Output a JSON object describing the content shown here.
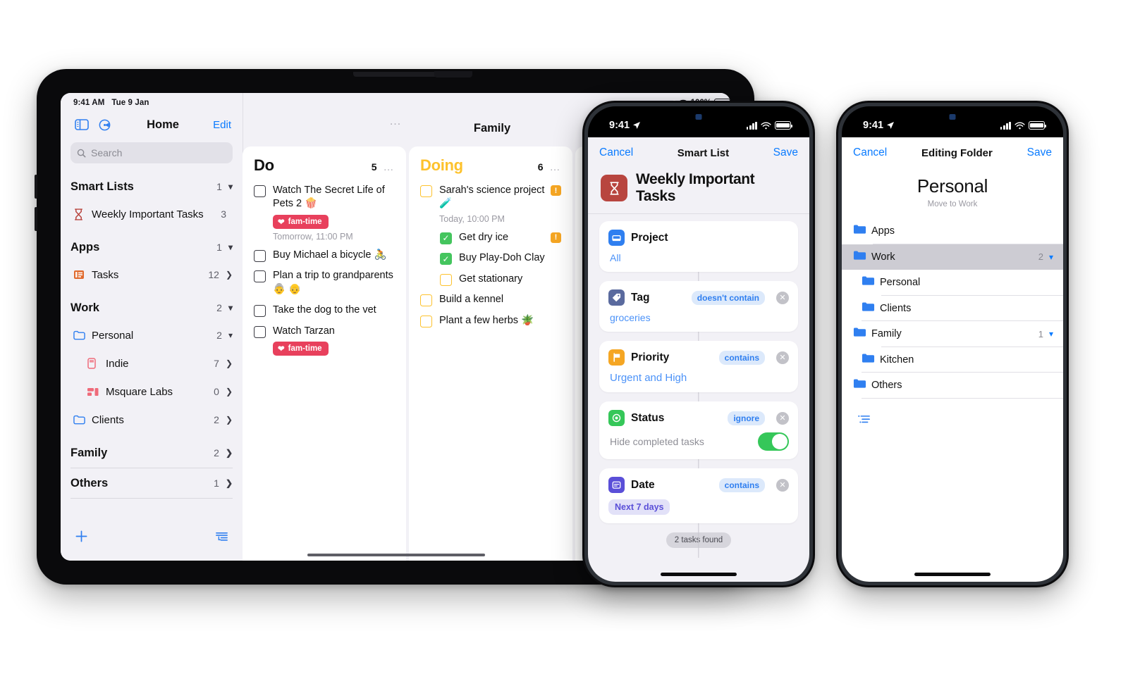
{
  "ipad": {
    "status": {
      "time": "9:41 AM",
      "date": "Tue 9 Jan",
      "battery": "100%"
    },
    "sidebar": {
      "title": "Home",
      "edit_label": "Edit",
      "search_placeholder": "Search",
      "sections": [
        {
          "name": "Smart Lists",
          "count": "1",
          "chevron": "down",
          "items": [
            {
              "label": "Weekly Important Tasks",
              "count": "3",
              "icon": "hourglass-icon",
              "trail": "none",
              "indent": 1
            }
          ]
        },
        {
          "name": "Apps",
          "count": "1",
          "chevron": "down",
          "items": [
            {
              "label": "Tasks",
              "count": "12",
              "icon": "tasks-app-icon",
              "trail": "chevron-right",
              "indent": 1
            }
          ]
        },
        {
          "name": "Work",
          "count": "2",
          "chevron": "down",
          "items": [
            {
              "label": "Personal",
              "count": "2",
              "icon": "folder-icon",
              "trail": "chevron-down",
              "indent": 1
            },
            {
              "label": "Indie",
              "count": "7",
              "icon": "indie-list-icon",
              "trail": "chevron-right",
              "indent": 2
            },
            {
              "label": "Msquare Labs",
              "count": "0",
              "icon": "msquare-list-icon",
              "trail": "chevron-right",
              "indent": 2
            },
            {
              "label": "Clients",
              "count": "2",
              "icon": "folder-icon",
              "trail": "chevron-right",
              "indent": 1
            }
          ]
        },
        {
          "name": "Family",
          "count": "2",
          "chevron": "right",
          "items": []
        },
        {
          "name": "Others",
          "count": "1",
          "chevron": "right",
          "items": []
        }
      ],
      "footer": {
        "add": "add-icon",
        "sort": "sort-options-icon"
      }
    },
    "content": {
      "title": "Family",
      "overflow": "more-options-icon",
      "columns": [
        {
          "name": "Do",
          "count": "5",
          "accent": "#111111",
          "tasks": [
            {
              "title": "Watch The Secret Life of Pets 2 🍿",
              "state": "open",
              "tag": "fam-time",
              "due": "Tomorrow, 11:00 PM",
              "priority": "",
              "sub": false
            },
            {
              "title": "Buy Michael a bicycle 🚴",
              "state": "open",
              "tag": "",
              "due": "",
              "priority": "",
              "sub": false
            },
            {
              "title": "Plan a trip to grandparents 👵 👴",
              "state": "open",
              "tag": "",
              "due": "",
              "priority": "",
              "sub": false
            },
            {
              "title": "Take the dog to the vet",
              "state": "open",
              "tag": "",
              "due": "",
              "priority": "",
              "sub": false
            },
            {
              "title": "Watch Tarzan",
              "state": "open",
              "tag": "fam-time",
              "due": "",
              "priority": "",
              "sub": false
            }
          ]
        },
        {
          "name": "Doing",
          "count": "6",
          "accent": "#fdc22d",
          "tasks": [
            {
              "title": "Sarah's science project 🧪",
              "state": "open-yellow",
              "tag": "",
              "due": "Today, 10:00 PM",
              "priority": "!",
              "sub": false
            },
            {
              "title": "Get dry ice",
              "state": "done",
              "tag": "",
              "due": "",
              "priority": "!",
              "sub": true
            },
            {
              "title": "Buy Play-Doh Clay",
              "state": "done",
              "tag": "",
              "due": "",
              "priority": "",
              "sub": true
            },
            {
              "title": "Get stationary",
              "state": "open-yellow",
              "tag": "",
              "due": "",
              "priority": "",
              "sub": true
            },
            {
              "title": "Build a kennel",
              "state": "open-yellow",
              "tag": "",
              "due": "",
              "priority": "",
              "sub": false
            },
            {
              "title": "Plant a few herbs 🪴",
              "state": "open-yellow",
              "tag": "",
              "due": "",
              "priority": "",
              "sub": false
            }
          ]
        }
      ]
    }
  },
  "phone_smartlist": {
    "status": {
      "time": "9:41"
    },
    "nav": {
      "cancel": "Cancel",
      "title": "Smart List",
      "save": "Save"
    },
    "list_name": "Weekly Important Tasks",
    "list_icon": "hourglass-icon",
    "filters": [
      {
        "name": "Project",
        "icon": "project-icon",
        "icon_color": "#2f7ff0",
        "operator": "",
        "value": "All",
        "value_kind": "link",
        "removable": false
      },
      {
        "name": "Tag",
        "icon": "tag-icon",
        "icon_color": "#5a6a9e",
        "operator": "doesn't contain",
        "value": "groceries",
        "value_kind": "link",
        "removable": true
      },
      {
        "name": "Priority",
        "icon": "flag-icon",
        "icon_color": "#f5a623",
        "operator": "contains",
        "value": "Urgent and High",
        "value_kind": "link",
        "removable": true
      },
      {
        "name": "Status",
        "icon": "status-icon",
        "icon_color": "#35c759",
        "operator": "ignore",
        "value": "Hide completed tasks",
        "value_kind": "toggle",
        "toggle_on": true,
        "removable": true
      },
      {
        "name": "Date",
        "icon": "calendar-icon",
        "icon_color": "#5a4fd8",
        "operator": "contains",
        "value": "Next 7 days",
        "value_kind": "chip",
        "removable": true
      }
    ],
    "result": "2 tasks found"
  },
  "phone_folder": {
    "status": {
      "time": "9:41"
    },
    "nav": {
      "cancel": "Cancel",
      "title": "Editing Folder",
      "save": "Save"
    },
    "folder_name": "Personal",
    "move_hint": "Move to Work",
    "rows": [
      {
        "label": "Apps",
        "count": "",
        "chevron": "",
        "indent": 0,
        "selected": false
      },
      {
        "label": "Work",
        "count": "2",
        "chevron": "down",
        "indent": 0,
        "selected": true
      },
      {
        "label": "Personal",
        "count": "",
        "chevron": "",
        "indent": 1,
        "selected": false
      },
      {
        "label": "Clients",
        "count": "",
        "chevron": "",
        "indent": 1,
        "selected": false
      },
      {
        "label": "Family",
        "count": "1",
        "chevron": "down",
        "indent": 0,
        "selected": false
      },
      {
        "label": "Kitchen",
        "count": "",
        "chevron": "",
        "indent": 1,
        "selected": false
      },
      {
        "label": "Others",
        "count": "",
        "chevron": "",
        "indent": 0,
        "selected": false
      }
    ],
    "footer_icon": "sort-options-icon"
  },
  "colors": {
    "accent_blue": "#0a7bff",
    "tag_red": "#e8405c",
    "doing_yellow": "#fdc22d",
    "done_green": "#44c55e",
    "priority_orange": "#f5a623",
    "smartlist_icon_red": "#b8453f"
  }
}
